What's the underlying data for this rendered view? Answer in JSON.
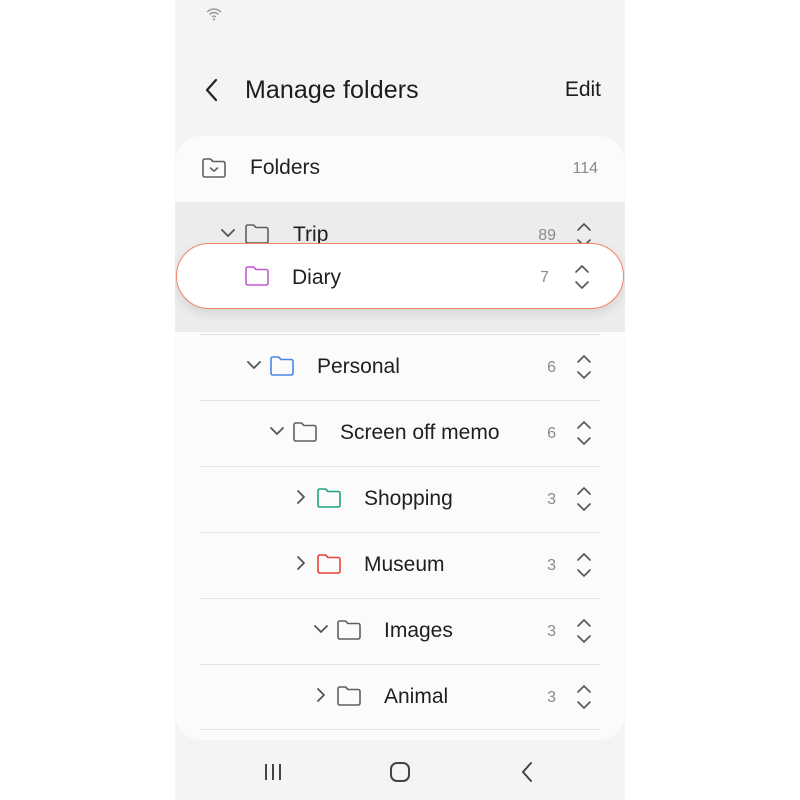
{
  "header": {
    "title": "Manage folders",
    "edit_label": "Edit"
  },
  "root": {
    "label": "Folders",
    "count": "114"
  },
  "folders": [
    {
      "label": "Trip",
      "count": "89",
      "color": "#606060",
      "expand": "expanded"
    },
    {
      "label": "Personal",
      "count": "6",
      "color": "#4a86e8",
      "expand": "expanded"
    },
    {
      "label": "Screen off memo",
      "count": "6",
      "color": "#606060",
      "expand": "expanded"
    },
    {
      "label": "Shopping",
      "count": "3",
      "color": "#1fa383",
      "expand": "collapsed"
    },
    {
      "label": "Museum",
      "count": "3",
      "color": "#e8433a",
      "expand": "collapsed"
    },
    {
      "label": "Images",
      "count": "3",
      "color": "#606060",
      "expand": "expanded"
    },
    {
      "label": "Animal",
      "count": "3",
      "color": "#606060",
      "expand": "collapsed"
    }
  ],
  "dragging": {
    "label": "Diary",
    "count": "7",
    "color": "#c25ad6"
  },
  "icons": {
    "status": "wifi-icon",
    "back": "back-arrow-icon",
    "folder": "folder-icon",
    "expand": "chevron-icon",
    "reorder": "reorder-handle-icon",
    "nav": [
      "recent-apps-icon",
      "home-icon",
      "nav-back-icon"
    ]
  }
}
